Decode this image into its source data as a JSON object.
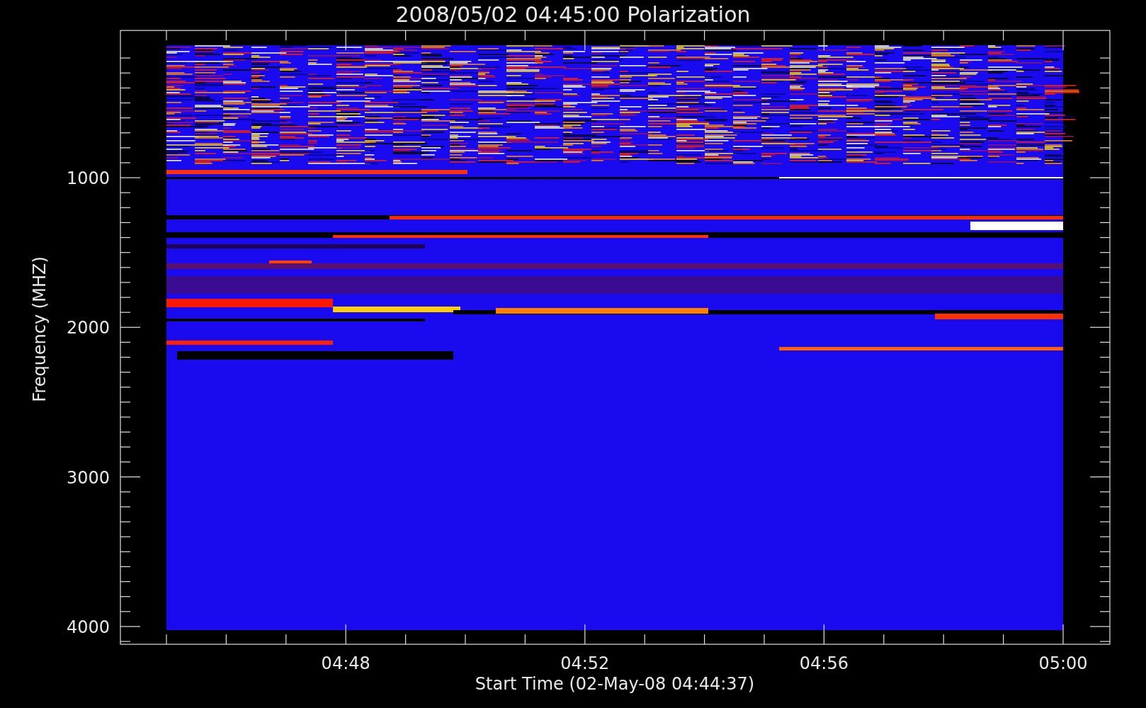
{
  "title": "2008/05/02 04:45:00 Polarization",
  "y_axis": {
    "label": "Frequency (MHZ)",
    "ticks": [
      "1000",
      "2000",
      "3000",
      "4000"
    ]
  },
  "x_axis": {
    "label": "Start Time (02-May-08 04:44:37)",
    "ticks": [
      "04:48",
      "04:52",
      "04:56",
      "05:00"
    ]
  }
}
